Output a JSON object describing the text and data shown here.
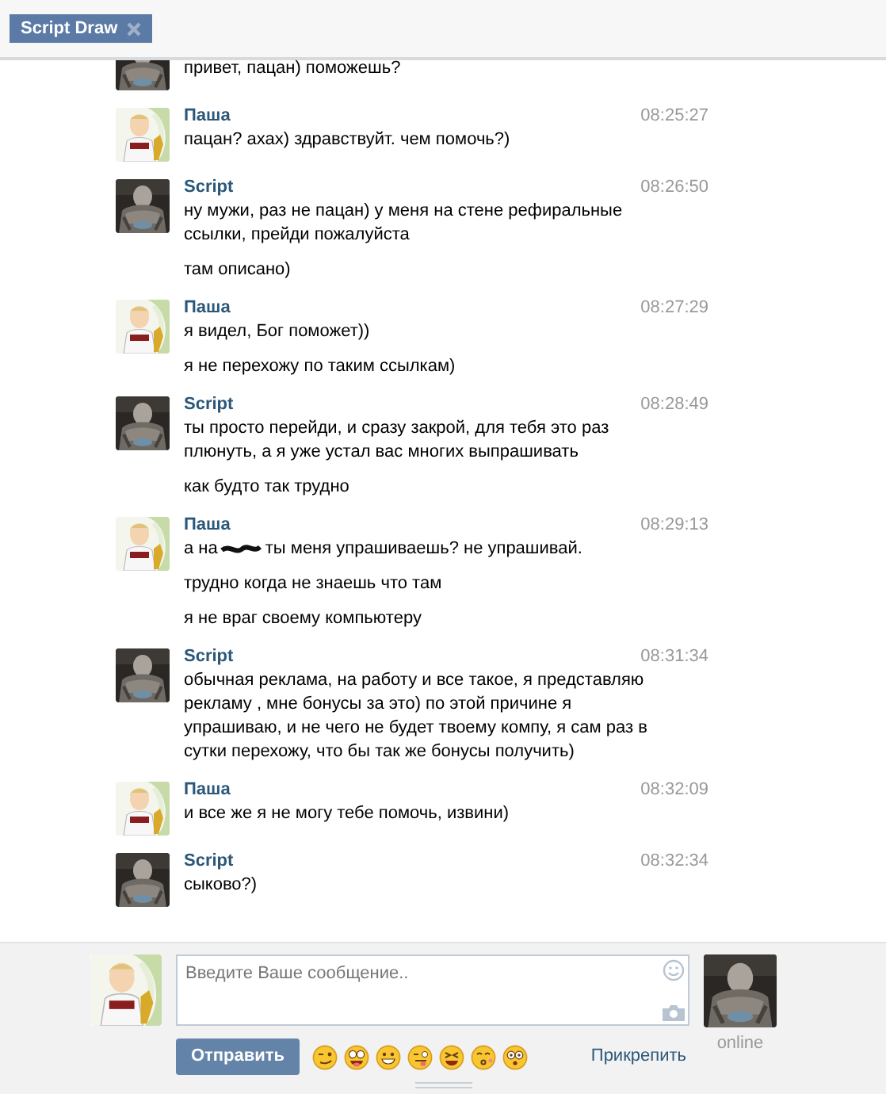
{
  "tab": {
    "label": "Script Draw",
    "selected": true
  },
  "messages": [
    {
      "kind": "script",
      "partial": true,
      "lines": [
        {
          "kind": "plain",
          "text": "привет, пацан) поможешь?"
        }
      ]
    },
    {
      "kind": "pasha",
      "name": "Паша",
      "time": "08:25:27",
      "lines": [
        {
          "kind": "plain",
          "text": "пацан? ахах) здравствуйт. чем помочь?)"
        }
      ]
    },
    {
      "kind": "script",
      "name": "Script",
      "time": "08:26:50",
      "lines": [
        {
          "kind": "plain",
          "text": "ну мужи, раз не пацан) у меня на стене рефиральные ссылки, прейди пожалуйста"
        },
        {
          "kind": "plain",
          "text": "там описано)"
        }
      ]
    },
    {
      "kind": "pasha",
      "name": "Паша",
      "time": "08:27:29",
      "lines": [
        {
          "kind": "plain",
          "text": "я видел, Бог поможет))"
        },
        {
          "kind": "plain",
          "text": "я не перехожу по таким ссылкам)"
        }
      ]
    },
    {
      "kind": "script",
      "name": "Script",
      "time": "08:28:49",
      "lines": [
        {
          "kind": "plain",
          "text": "ты просто перейди, и сразу закрой, для тебя это раз плюнуть, а я уже устал вас многих выпрашивать"
        },
        {
          "kind": "plain",
          "text": "как будто так трудно"
        }
      ]
    },
    {
      "kind": "pasha",
      "name": "Паша",
      "time": "08:29:13",
      "lines": [
        {
          "kind": "redacted",
          "before": "а на",
          "after": "ты меня упрашиваешь? не упрашивай."
        },
        {
          "kind": "plain",
          "text": "трудно когда не знаешь что там"
        },
        {
          "kind": "plain",
          "text": "я не враг своему компьютеру"
        }
      ]
    },
    {
      "kind": "script",
      "name": "Script",
      "time": "08:31:34",
      "lines": [
        {
          "kind": "plain",
          "text": "обычная реклама, на работу и все такое, я представляю рекламу , мне бонусы за это) по этой причине я упрашиваю, и не чего не будет твоему компу, я сам раз в сутки перехожу, что бы так же бонусы получить)"
        }
      ]
    },
    {
      "kind": "pasha",
      "name": "Паша",
      "time": "08:32:09",
      "lines": [
        {
          "kind": "plain",
          "text": "и все же я не могу тебе помочь, извини)"
        }
      ]
    },
    {
      "kind": "script",
      "name": "Script",
      "time": "08:32:34",
      "lines": [
        {
          "kind": "plain",
          "text": "сыково?)"
        }
      ]
    }
  ],
  "composer": {
    "placeholder": "Введите Ваше сообщение..",
    "send": "Отправить",
    "attach": "Прикрепить",
    "peer_status": "online",
    "emojis": [
      {
        "kind": "wink"
      },
      {
        "kind": "tongue"
      },
      {
        "kind": "grin"
      },
      {
        "kind": "wink-tongue"
      },
      {
        "kind": "squint"
      },
      {
        "kind": "kiss"
      },
      {
        "kind": "shock"
      }
    ]
  }
}
